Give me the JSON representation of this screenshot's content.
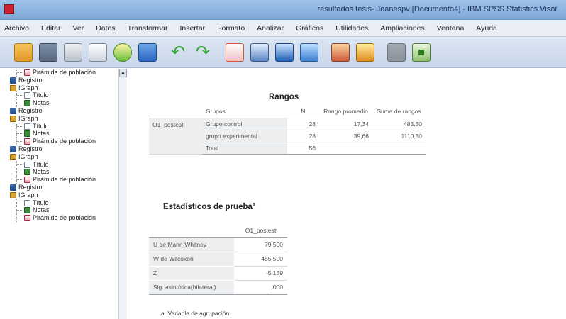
{
  "window": {
    "title": "resultados tesis- Joanespv [Documento4] - IBM SPSS Statistics Visor"
  },
  "menu": [
    "Archivo",
    "Editar",
    "Ver",
    "Datos",
    "Transformar",
    "Insertar",
    "Formato",
    "Analizar",
    "Gráficos",
    "Utilidades",
    "Ampliaciones",
    "Ventana",
    "Ayuda"
  ],
  "toolbar_icons": [
    "open-icon",
    "save-icon",
    "print-icon",
    "print-preview-icon",
    "export-icon",
    "recall-dialog-icon",
    "undo-icon",
    "redo-icon",
    "goto-case-icon",
    "variables-icon",
    "create-chart-icon",
    "table-icon",
    "select-cases-icon",
    "weight-cases-icon",
    "disabled-icon",
    "insert-output-icon"
  ],
  "outline": [
    {
      "label": "Pirámide de población",
      "type": "piramide",
      "level": 2
    },
    {
      "label": "Registro",
      "type": "registro",
      "level": 1
    },
    {
      "label": "IGraph",
      "type": "igraph",
      "level": 1
    },
    {
      "label": "Título",
      "type": "titulo",
      "level": 2
    },
    {
      "label": "Notas",
      "type": "notas",
      "level": 2
    },
    {
      "label": "Registro",
      "type": "registro",
      "level": 1
    },
    {
      "label": "IGraph",
      "type": "igraph",
      "level": 1
    },
    {
      "label": "Título",
      "type": "titulo",
      "level": 2
    },
    {
      "label": "Notas",
      "type": "notas",
      "level": 2
    },
    {
      "label": "Pirámide de población",
      "type": "piramide",
      "level": 2
    },
    {
      "label": "Registro",
      "type": "registro",
      "level": 1
    },
    {
      "label": "IGraph",
      "type": "igraph",
      "level": 1
    },
    {
      "label": "Título",
      "type": "titulo",
      "level": 2
    },
    {
      "label": "Notas",
      "type": "notas",
      "level": 2
    },
    {
      "label": "Pirámide de población",
      "type": "piramide",
      "level": 2
    },
    {
      "label": "Registro",
      "type": "registro",
      "level": 1
    },
    {
      "label": "IGraph",
      "type": "igraph",
      "level": 1
    },
    {
      "label": "Título",
      "type": "titulo",
      "level": 2
    },
    {
      "label": "Notas",
      "type": "notas",
      "level": 2
    },
    {
      "label": "Pirámide de población",
      "type": "piramide",
      "level": 2
    }
  ],
  "rangos": {
    "title": "Rangos",
    "headers": {
      "grupos": "Grupos",
      "n": "N",
      "rango": "Rango promedio",
      "suma": "Suma de rangos"
    },
    "row_label": "O1_postest",
    "rows": [
      {
        "group": "Grupo control",
        "n": "28",
        "rango": "17,34",
        "suma": "485,50"
      },
      {
        "group": "grupo experimental",
        "n": "28",
        "rango": "39,66",
        "suma": "1110,50"
      },
      {
        "group": "Total",
        "n": "56",
        "rango": "",
        "suma": ""
      }
    ]
  },
  "estadisticos": {
    "title": "Estadísticos de prueba",
    "title_sup": "a",
    "column": "O1_postest",
    "rows": [
      {
        "label": "U de Mann-Whitney",
        "value": "79,500"
      },
      {
        "label": "W de Wilcoxon",
        "value": "485,500"
      },
      {
        "label": "Z",
        "value": "-5,159"
      },
      {
        "label": "Sig. asintótica(bilateral)",
        "value": ",000"
      }
    ],
    "footnote": "a. Variable de agrupación"
  }
}
